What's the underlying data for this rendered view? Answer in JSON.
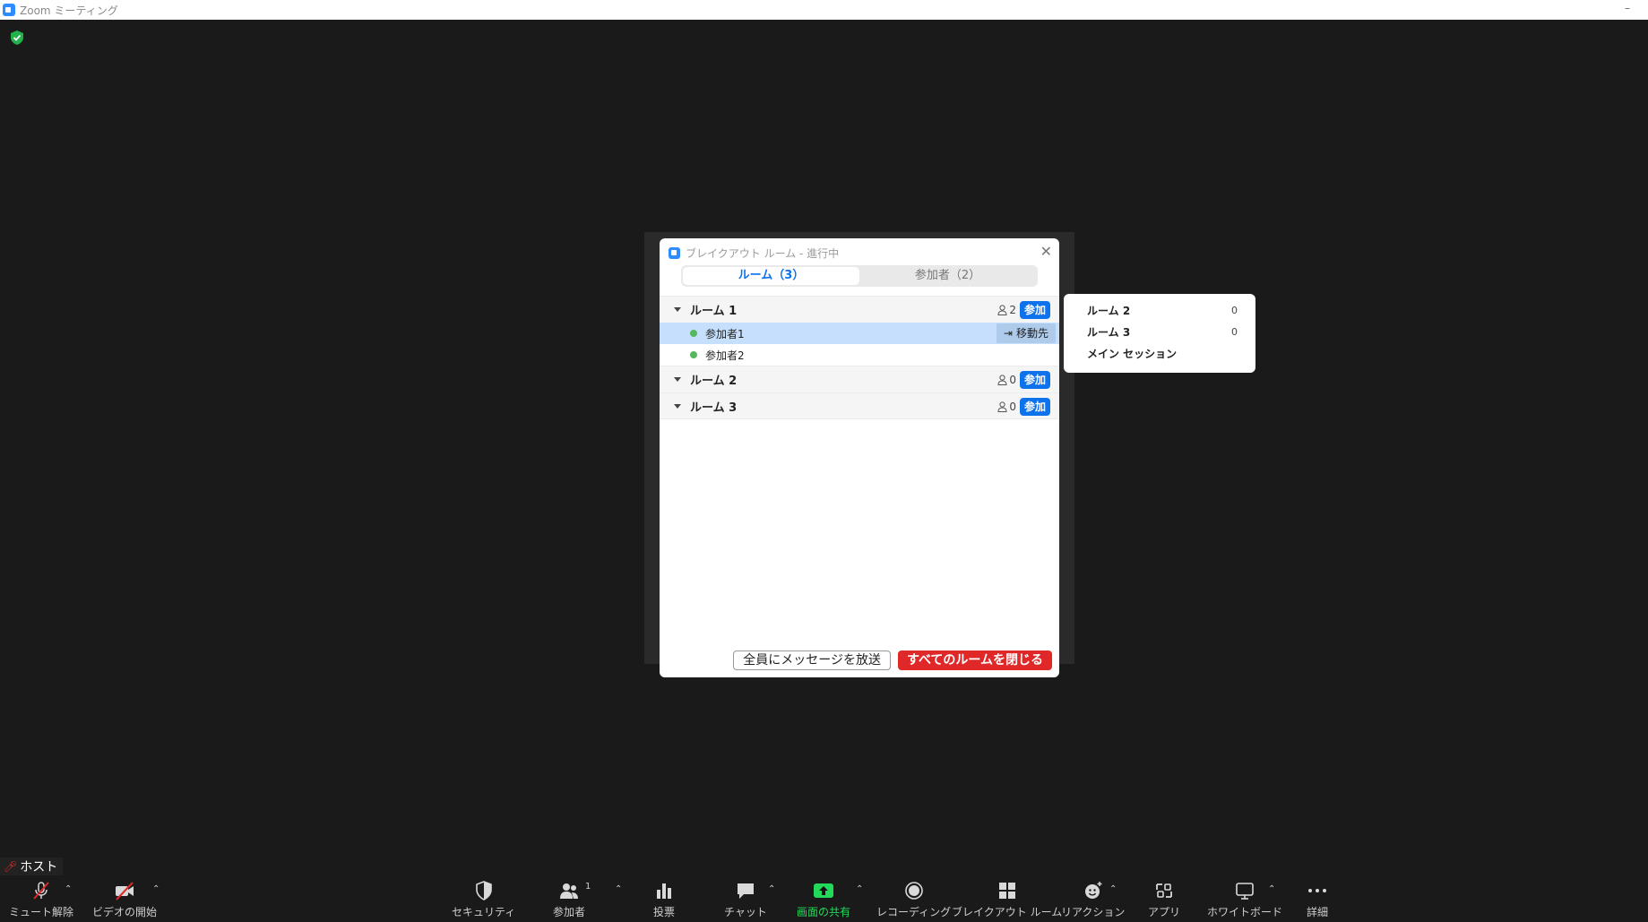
{
  "window": {
    "title": "Zoom ミーティング",
    "minimize": "–"
  },
  "dialog": {
    "title": "ブレイクアウト ルーム - 進行中",
    "close": "✕",
    "tabs": [
      {
        "label": "ルーム（3）"
      },
      {
        "label": "参加者（2）"
      }
    ],
    "rooms": [
      {
        "name": "ルーム 1",
        "count": "2",
        "join": "参加",
        "participants": [
          {
            "name": "参加者1",
            "move": "移動先"
          },
          {
            "name": "参加者2"
          }
        ]
      },
      {
        "name": "ルーム 2",
        "count": "0",
        "join": "参加"
      },
      {
        "name": "ルーム 3",
        "count": "0",
        "join": "参加"
      }
    ],
    "broadcast": "全員にメッセージを放送",
    "close_all": "すべてのルームを閉じる"
  },
  "move_popup": {
    "items": [
      {
        "label": "ルーム 2",
        "count": "0"
      },
      {
        "label": "ルーム 3",
        "count": "0"
      },
      {
        "label": "メイン セッション",
        "count": ""
      }
    ]
  },
  "host_label": "ホスト",
  "toolbar": {
    "mute": "ミュート解除",
    "video": "ビデオの開始",
    "security": "セキュリティ",
    "participants": "参加者",
    "participants_count": "1",
    "polls": "投票",
    "chat": "チャット",
    "share": "画面の共有",
    "record": "レコーディング",
    "breakout": "ブレイクアウト ルーム",
    "reactions": "リアクション",
    "apps": "アプリ",
    "whiteboard": "ホワイトボード",
    "more": "詳細"
  },
  "colors": {
    "accent": "#0e72ed",
    "danger": "#e02828",
    "share_green": "#23d959",
    "online": "#55b85c"
  }
}
